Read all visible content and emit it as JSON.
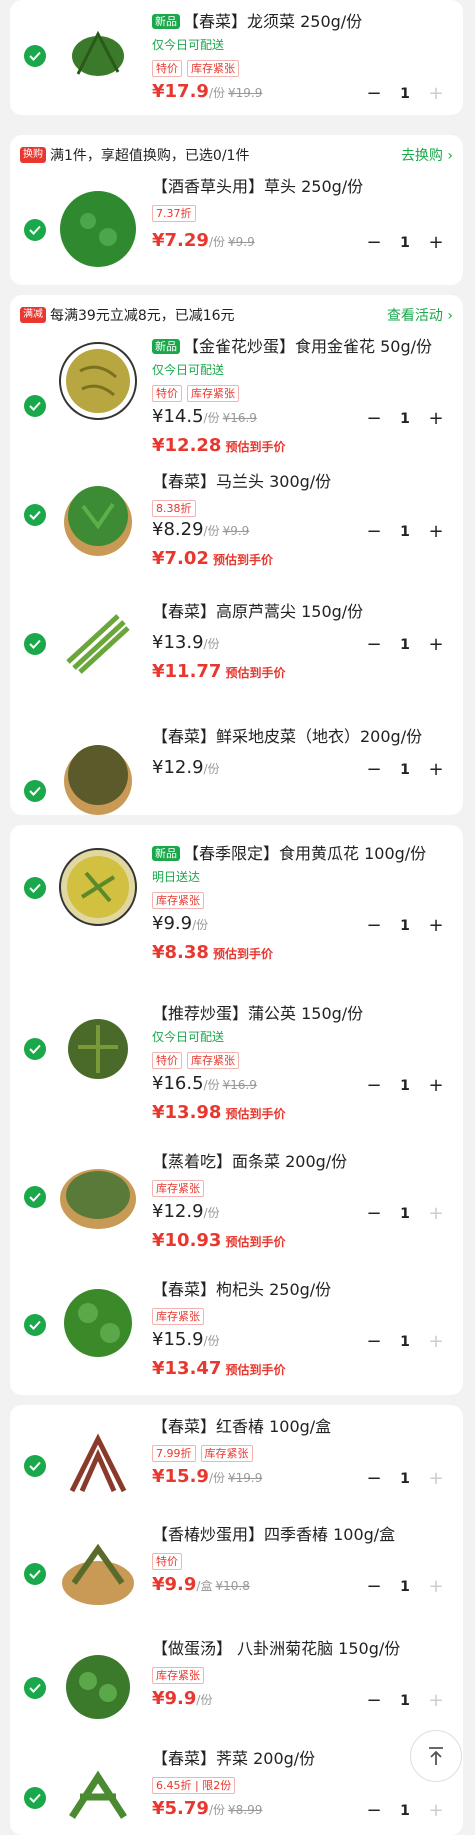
{
  "banners": {
    "b1": {
      "badge": "换购",
      "text": "满1件，享超值换购，已选0/1件",
      "link": "去换购 ›"
    },
    "b2": {
      "badge": "满减",
      "text": "每满39元立减8元，已减16元",
      "link": "查看活动 ›"
    }
  },
  "labels": {
    "estimate": "预估到手价",
    "new_tag": "新品"
  },
  "items": [
    {
      "title": "【春菜】龙须菜 250g/份",
      "sub": "仅今日可配送",
      "tags": [
        "特价",
        "库存紧张"
      ],
      "price": "¥17.9",
      "unit": "/份",
      "orig": "¥19.9",
      "qty": "1",
      "img_color": "#3a7a2a"
    },
    {
      "title": "【酒香草头用】草头 250g/份",
      "tags": [
        "7.37折"
      ],
      "price": "¥7.29",
      "unit": "/份",
      "orig": "¥9.9",
      "qty": "1",
      "img_color": "#2f8a2f"
    },
    {
      "title": "【金雀花炒蛋】食用金雀花 50g/份",
      "sub": "仅今日可配送",
      "tags": [
        "特价",
        "库存紧张"
      ],
      "price": "¥14.5",
      "unit": "/份",
      "orig": "¥16.9",
      "est": "¥12.28",
      "qty": "1",
      "img_color": "#b8a640"
    },
    {
      "title": "【春菜】马兰头 300g/份",
      "tags": [
        "8.38折"
      ],
      "price": "¥8.29",
      "unit": "/份",
      "orig": "¥9.9",
      "est": "¥7.02",
      "qty": "1",
      "img_color": "#3d8b35"
    },
    {
      "title": "【春菜】高原芦蒿尖 150g/份",
      "price": "¥13.9",
      "unit": "/份",
      "est": "¥11.77",
      "qty": "1",
      "img_color": "#6aa63a"
    },
    {
      "title": "【春菜】鲜采地皮菜（地衣）200g/份",
      "price": "¥12.9",
      "unit": "/份",
      "qty": "1",
      "img_color": "#5a5a2a"
    },
    {
      "title": "【春季限定】食用黄瓜花 100g/份",
      "sub": "明日送达",
      "tags": [
        "库存紧张"
      ],
      "price": "¥9.9",
      "unit": "/份",
      "est": "¥8.38",
      "qty": "1",
      "img_color": "#d2c040"
    },
    {
      "title": "【推荐炒蛋】蒲公英 150g/份",
      "sub": "仅今日可配送",
      "tags": [
        "特价",
        "库存紧张"
      ],
      "price": "¥16.5",
      "unit": "/份",
      "orig": "¥16.9",
      "est": "¥13.98",
      "qty": "1",
      "img_color": "#4a6a2a"
    },
    {
      "title": "【蒸着吃】面条菜 200g/份",
      "tags": [
        "库存紧张"
      ],
      "price": "¥12.9",
      "unit": "/份",
      "est": "¥10.93",
      "qty": "1",
      "img_color": "#5a7a3a"
    },
    {
      "title": "【春菜】枸杞头 250g/份",
      "tags": [
        "库存紧张"
      ],
      "price": "¥15.9",
      "unit": "/份",
      "est": "¥13.47",
      "qty": "1",
      "img_color": "#3a8a2a"
    },
    {
      "title": "【春菜】红香椿 100g/盒",
      "tags": [
        "7.99折",
        "库存紧张"
      ],
      "price": "¥15.9",
      "unit": "/份",
      "orig": "¥19.9",
      "qty": "1",
      "img_color": "#8a3a2a"
    },
    {
      "title": "【香椿炒蛋用】四季香椿 100g/盒",
      "tags": [
        "特价"
      ],
      "price": "¥9.9",
      "unit": "/盒",
      "orig": "¥10.8",
      "qty": "1",
      "img_color": "#5a6a2a"
    },
    {
      "title": "【做蛋汤】 八卦洲菊花脑 150g/份",
      "tags": [
        "库存紧张"
      ],
      "price": "¥9.9",
      "unit": "/份",
      "qty": "1",
      "img_color": "#3a7a2a"
    },
    {
      "title": "【春菜】荠菜 200g/份",
      "tags": [
        "6.45折 | 限2份"
      ],
      "price": "¥5.79",
      "unit": "/份",
      "orig": "¥8.99",
      "qty": "1",
      "img_color": "#4a8a30"
    }
  ]
}
